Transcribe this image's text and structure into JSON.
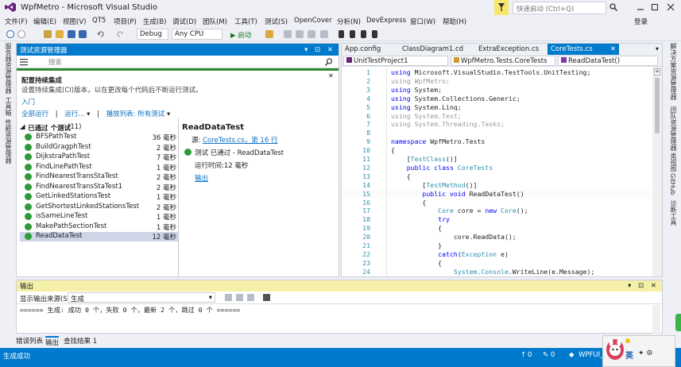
{
  "window": {
    "title": "WpfMetro - Microsoft Visual Studio",
    "quick_launch_placeholder": "快速启动 (Ctrl+Q)",
    "signin": "登录"
  },
  "menu": [
    "文件(F)",
    "编辑(E)",
    "视图(V)",
    "QT5",
    "项目(P)",
    "生成(B)",
    "调试(D)",
    "团队(M)",
    "工具(T)",
    "测试(S)",
    "OpenCover",
    "分析(N)",
    "DevExpress",
    "窗口(W)",
    "帮助(H)"
  ],
  "toolbar": {
    "config": "Debug",
    "platform": "Any CPU",
    "start_label": "▶ 启动"
  },
  "left_tabs": [
    "服务器资源管理器",
    "工具箱",
    "性能资源管理器"
  ],
  "right_tabs": [
    "解决方案资源管理器",
    "团队资源管理器",
    "类视图",
    "GitHub",
    "诊断工具"
  ],
  "test_explorer": {
    "title": "测试资源管理器",
    "search_placeholder": "搜索",
    "ci_title": "配置持续集成",
    "ci_desc": "设置持续集成(CI)版本，以在更改每个代码后不断运行测试。",
    "ci_link": "入门",
    "run_all": "全部运行",
    "run_menu": "运行...",
    "playlist": "播放列表: 所有测试",
    "group_header": "已通过 个测试",
    "group_count": "(11)",
    "tests": [
      {
        "name": "BFSPathTest",
        "time": "36 毫秒"
      },
      {
        "name": "BuildGragphTest",
        "time": "2 毫秒"
      },
      {
        "name": "DijkstraPathTest",
        "time": "7 毫秒"
      },
      {
        "name": "FindLinePathTest",
        "time": "1 毫秒"
      },
      {
        "name": "FindNearestTransStaTest",
        "time": "2 毫秒"
      },
      {
        "name": "FindNearestTransStaTest1",
        "time": "2 毫秒"
      },
      {
        "name": "GetLinkedStationsTest",
        "time": "1 毫秒"
      },
      {
        "name": "GetShortestLinkedStationsTest",
        "time": "2 毫秒"
      },
      {
        "name": "isSameLineTest",
        "time": "1 毫秒"
      },
      {
        "name": "MakePathSectionTest",
        "time": "1 毫秒"
      },
      {
        "name": "ReadDataTest",
        "time": "12 毫秒"
      }
    ],
    "detail": {
      "name": "ReadDataTest",
      "source_prefix": "源: ",
      "source_link": "CoreTests.cs，第 16 行",
      "result": "测试 已通过 - ReadDataTest",
      "elapsed": "运行时间:12 毫秒",
      "output_link": "输出"
    }
  },
  "editor": {
    "tabs": [
      "App.config",
      "ClassDiagram1.cd",
      "ExtraException.cs",
      "CoreTests.cs"
    ],
    "nav": {
      "project": "UnitTestProject1",
      "class": "WpfMetro.Tests.CoreTests",
      "member": "ReadDataTest()"
    },
    "lines": [
      {
        "n": "1",
        "segs": [
          [
            "kw",
            "using"
          ],
          [
            "",
            "Microsoft.VisualStudio.TestTools.UnitTesting;"
          ]
        ]
      },
      {
        "n": "2",
        "segs": [
          [
            "gray",
            "using WpfMetro;"
          ]
        ]
      },
      {
        "n": "3",
        "segs": [
          [
            "kw",
            "using"
          ],
          [
            "",
            "System;"
          ]
        ]
      },
      {
        "n": "4",
        "segs": [
          [
            "kw",
            "using"
          ],
          [
            "",
            "System.Collections.Generic;"
          ]
        ]
      },
      {
        "n": "5",
        "segs": [
          [
            "kw",
            "using"
          ],
          [
            "",
            "System.Linq;"
          ]
        ]
      },
      {
        "n": "6",
        "segs": [
          [
            "gray",
            "using System.Text;"
          ]
        ]
      },
      {
        "n": "7",
        "segs": [
          [
            "gray",
            "using System.Threading.Tasks;"
          ]
        ]
      },
      {
        "n": "8",
        "segs": []
      },
      {
        "n": "9",
        "segs": [
          [
            "kw",
            "namespace"
          ],
          [
            "",
            "WpfMetro.Tests"
          ]
        ]
      },
      {
        "n": "10",
        "segs": [
          [
            "",
            "{"
          ]
        ]
      },
      {
        "n": "11",
        "segs": [
          [
            "",
            "    ["
          ],
          [
            "ty",
            "TestClass"
          ],
          [
            "",
            "()]"
          ]
        ]
      },
      {
        "n": "12",
        "segs": [
          [
            "kw",
            "    public class"
          ],
          [
            "ty",
            "CoreTests"
          ]
        ]
      },
      {
        "n": "13",
        "segs": [
          [
            "",
            "    {"
          ]
        ]
      },
      {
        "n": "14",
        "segs": [
          [
            "",
            "        ["
          ],
          [
            "ty",
            "TestMethod"
          ],
          [
            "",
            "()]"
          ]
        ]
      },
      {
        "n": "15",
        "segs": [
          [
            "kw",
            "        public void"
          ],
          [
            "",
            "ReadDataTest()"
          ]
        ]
      },
      {
        "n": "16",
        "segs": [
          [
            "",
            "        {"
          ]
        ]
      },
      {
        "n": "17",
        "segs": [
          [
            "ty",
            "            Core"
          ],
          [
            "",
            "core ="
          ],
          [
            "kw",
            "new"
          ],
          [
            "ty",
            "Core"
          ],
          [
            "",
            "();"
          ]
        ]
      },
      {
        "n": "18",
        "segs": [
          [
            "kw",
            "            try"
          ]
        ]
      },
      {
        "n": "19",
        "segs": [
          [
            "",
            "            {"
          ]
        ]
      },
      {
        "n": "20",
        "segs": [
          [
            "",
            "                core.ReadData();"
          ]
        ]
      },
      {
        "n": "21",
        "segs": [
          [
            "",
            "            }"
          ]
        ]
      },
      {
        "n": "22",
        "segs": [
          [
            "kw",
            "            catch"
          ],
          [
            "",
            "("
          ],
          [
            "ty",
            "Exception"
          ],
          [
            "",
            "e)"
          ]
        ]
      },
      {
        "n": "23",
        "segs": [
          [
            "",
            "            {"
          ]
        ]
      },
      {
        "n": "24",
        "segs": [
          [
            "ty",
            "                System.Console"
          ],
          [
            "",
            ".WriteLine(e.Message);"
          ]
        ]
      }
    ]
  },
  "output": {
    "title": "输出",
    "source_label": "显示输出来源(S):",
    "source_value": "生成",
    "text": "====== 生成: 成功 0 个，失败 0 个，最新 2 个，跳过 0 个 ======"
  },
  "bottom_tabs": [
    "错误列表",
    "输出",
    "查找结果 1"
  ],
  "status": {
    "left": "生成成功",
    "up_count": "0",
    "pencil_count": "0",
    "branch": "WPFUI_",
    "ime": "英"
  },
  "colors": {
    "accent": "#007acc",
    "pass": "#2e9b3a",
    "output_head": "#f5f0a8"
  }
}
